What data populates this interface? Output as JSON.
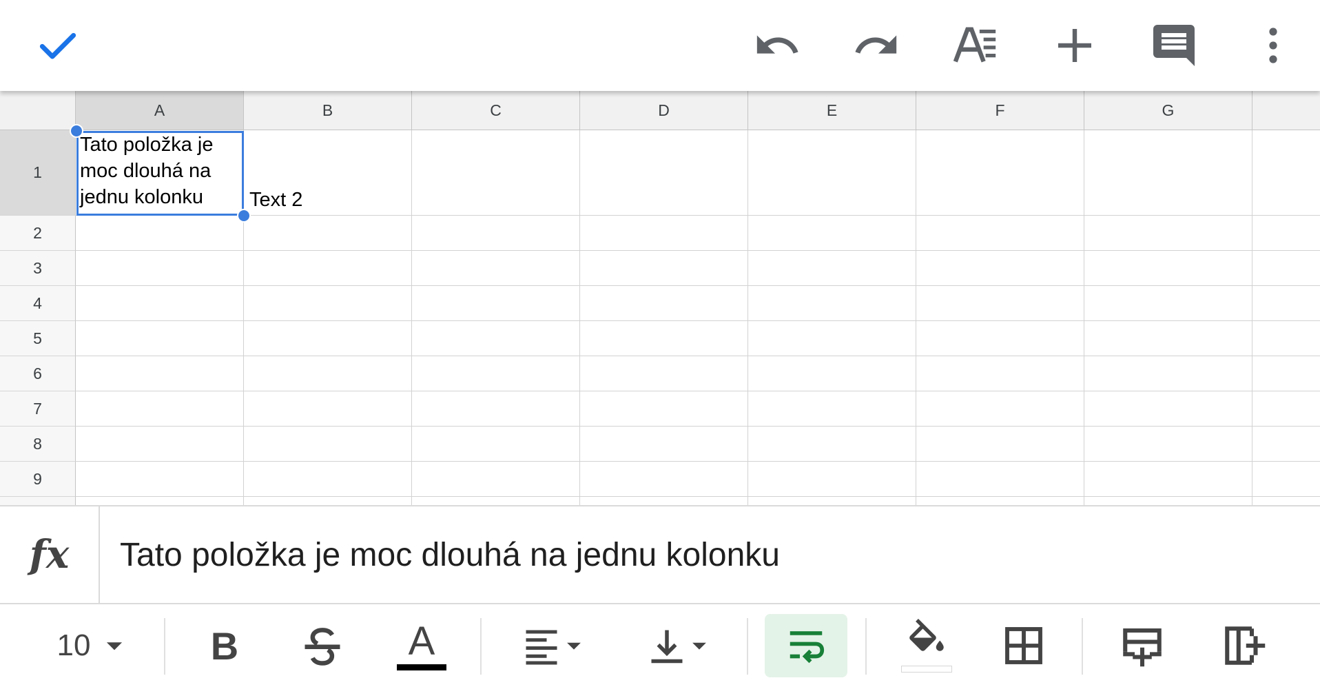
{
  "appbar": {
    "done_icon": "check-icon",
    "undo_icon": "undo-icon",
    "redo_icon": "redo-icon",
    "format_icon": "text-format-icon",
    "insert_icon": "plus-icon",
    "comment_icon": "comment-icon",
    "more_icon": "more-vert-icon",
    "accent_color": "#1a73e8"
  },
  "sheet": {
    "columns": [
      "A",
      "B",
      "C",
      "D",
      "E",
      "F",
      "G"
    ],
    "rows": [
      "1",
      "2",
      "3",
      "4",
      "5",
      "6",
      "7",
      "8",
      "9"
    ],
    "selected_cell": "A1",
    "selection_color": "#3b7ddd",
    "cells": {
      "A1": "Tato položka je moc dlouhá na jednu kolonku",
      "B1": "Text 2"
    }
  },
  "formula_bar": {
    "fx_label": "fx",
    "value": "Tato položka je moc dlouhá na jednu kolonku"
  },
  "format_toolbar": {
    "font_size": "10",
    "bold_label": "B",
    "text_color_label": "A",
    "wrap_active": true,
    "wrap_active_color": "#188038",
    "icons": [
      "dropdown-icon",
      "bold-icon",
      "strikethrough-icon",
      "text-color-icon",
      "horizontal-align-icon",
      "vertical-align-icon",
      "wrap-text-icon",
      "fill-color-icon",
      "borders-icon",
      "insert-row-icon",
      "insert-column-icon"
    ]
  }
}
